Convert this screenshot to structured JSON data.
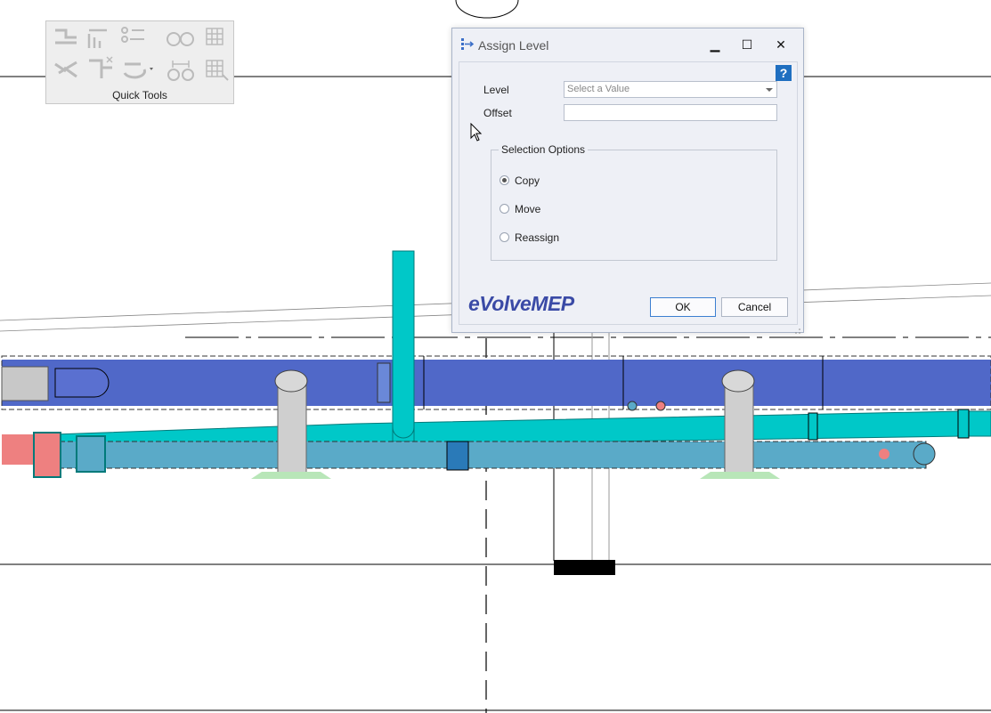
{
  "quick_tools": {
    "label": "Quick Tools",
    "tools": [
      "route-icon",
      "multi-route-icon",
      "connect-icon",
      "pipe-circles-icon",
      "grid-select-icon",
      "split-icon",
      "fitting-icon",
      "rotate-icon",
      "spacing-icon",
      "grid-edit-icon"
    ]
  },
  "dialog": {
    "title": "Assign Level",
    "help": "?",
    "level_label": "Level",
    "level_placeholder": "Select a Value",
    "offset_label": "Offset",
    "offset_value": "",
    "selection_title": "Selection Options",
    "options": [
      {
        "label": "Copy",
        "selected": true
      },
      {
        "label": "Move",
        "selected": false
      },
      {
        "label": "Reassign",
        "selected": false
      }
    ],
    "brand": "eVolveMEP",
    "ok_label": "OK",
    "cancel_label": "Cancel"
  },
  "colors": {
    "duct_blue": "#5068c8",
    "pipe_cyan": "#00c8c8",
    "pipe_blue": "#5aaac8",
    "fitting_grey": "#cfcfcf",
    "hot_red": "#ee8080",
    "accent": "#1f6fc0"
  }
}
